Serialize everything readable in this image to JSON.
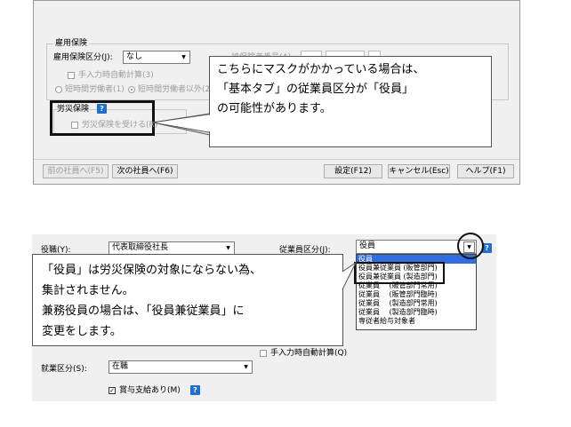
{
  "top_dialog": {
    "employment_insurance": {
      "title": "雇用保険",
      "category_label": "雇用保険区分(J):",
      "category_value": "なし",
      "auto_calc_label": "手入力時自動計算(3)",
      "short_time_label": "短時間労働者(1)",
      "non_short_time_label": "短時間労働者以外(2)",
      "hidden_label_fragment": "被保険者番号(A)"
    },
    "workers_comp": {
      "title": "労災保険",
      "help": "?",
      "receive_label": "労災保険を受ける(R)"
    },
    "buttons": {
      "prev": "前の社員へ(F5)",
      "next": "次の社員へ(F6)",
      "settings": "設定(F12)",
      "cancel": "キャンセル(Esc)",
      "help": "ヘルプ(F1)"
    },
    "callout_lines": [
      "こちらにマスクがかかっている場合は、",
      "「基本タブ」の従業員区分が「役員」",
      "の可能性があります。"
    ]
  },
  "bottom_panel": {
    "position_label": "役職(Y):",
    "position_value": "代表取締役社長",
    "employee_category_label": "従業員区分(J):",
    "employee_category_value": "役員",
    "employee_category_options": [
      "役員",
      "役員兼従業員 (販管部門)",
      "役員兼従業員 (製造部門)",
      "従業員　 (販管部門常用)",
      "従業員　 (販管部門臨時)",
      "従業員　 (製造部門常用)",
      "従業員　 (製造部門臨時)",
      "専従者給与対象者"
    ],
    "auto_calc_label": "手入力時自動計算(Q)",
    "work_status_label": "就業区分(S):",
    "work_status_value": "在職",
    "bonus_label": "賞与支給あり(M)",
    "help": "?",
    "callout_lines": [
      "「役員」は労災保険の対象にならない為、",
      "集計されません。",
      "兼務役員の場合は、「役員兼従業員」に",
      "変更をします。"
    ]
  }
}
